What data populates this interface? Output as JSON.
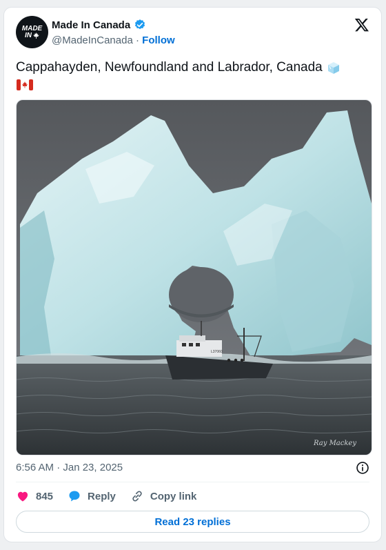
{
  "author": {
    "display_name": "Made In Canada",
    "handle": "@MadeInCanada",
    "separator": "·",
    "follow_label": "Follow",
    "avatar_line1": "MADE",
    "avatar_line2": "IN",
    "verified": true
  },
  "tweet": {
    "text": "Cappahayden, Newfoundland and Labrador, Canada",
    "emojis": [
      "ice-cube",
      "canada-flag"
    ]
  },
  "media": {
    "watermark": "Ray Mackey",
    "boat_label": "L37060",
    "description_icon": "iceberg-photo"
  },
  "meta": {
    "timestamp": "6:56 AM · Jan 23, 2025"
  },
  "actions": {
    "likes": "845",
    "reply_label": "Reply",
    "copy_link_label": "Copy link"
  },
  "footer": {
    "read_replies_label": "Read 23 replies"
  },
  "colors": {
    "link_blue": "#006fd6",
    "heart_pink": "#f91880",
    "reply_blue": "#1d9bf0",
    "text_dark": "#0f1419",
    "text_gray": "#536471"
  }
}
